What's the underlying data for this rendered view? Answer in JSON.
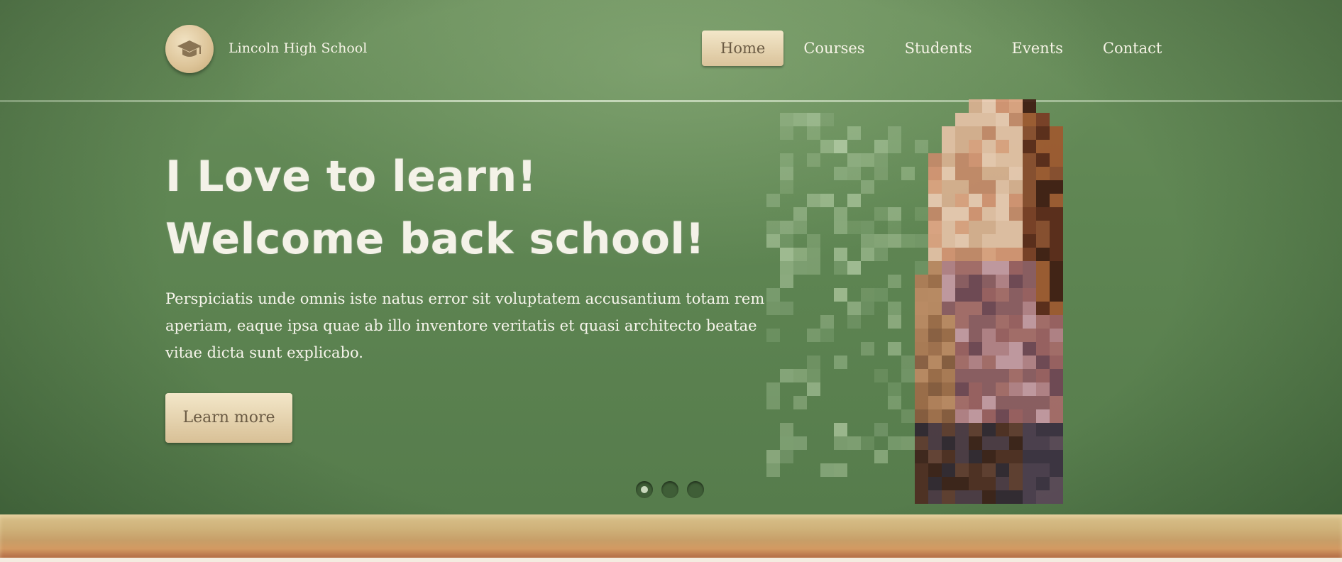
{
  "header": {
    "brand": "Lincoln High School",
    "logo_icon": "graduation-cap-icon",
    "nav": [
      {
        "label": "Home",
        "active": true
      },
      {
        "label": "Courses",
        "active": false
      },
      {
        "label": "Students",
        "active": false
      },
      {
        "label": "Events",
        "active": false
      },
      {
        "label": "Contact",
        "active": false
      }
    ]
  },
  "hero": {
    "title_line1": "I Love to learn!",
    "title_line2": "Welcome back school!",
    "description": "Perspiciatis unde omnis iste natus error sit voluptatem accusantium totam rem aperiam, eaque ipsa quae ab illo inventore veritatis et quasi architecto beatae vitae dicta sunt explicabo.",
    "cta_label": "Learn more",
    "slides": [
      {
        "active": true
      },
      {
        "active": false
      },
      {
        "active": false
      }
    ]
  },
  "colors": {
    "chalkboard": "#5f8653",
    "button": "#dcc59d",
    "button_text": "#6b5b44",
    "text": "#f6f3e6",
    "wood": "#cfb27a"
  }
}
